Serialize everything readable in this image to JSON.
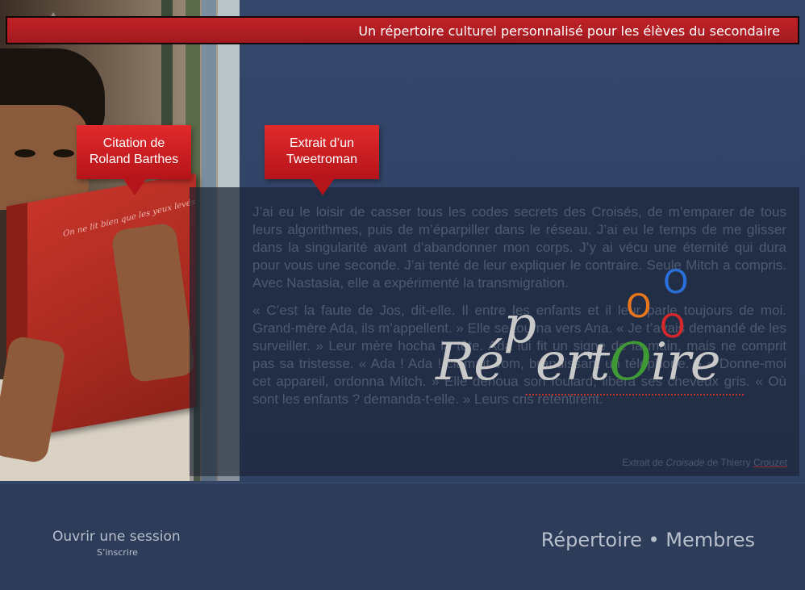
{
  "banner": {
    "tagline": "Un répertoire culturel personnalisé pour les élèves du secondaire"
  },
  "callouts": {
    "quote": {
      "line1": "Citation de",
      "line2": "Roland Barthes"
    },
    "excerpt": {
      "line1": "Extrait d’un",
      "line2": "Tweetroman"
    }
  },
  "book": {
    "cover_text": "On ne lit bien que les yeux levés"
  },
  "excerpt": {
    "paragraph1": "J’ai eu le loisir de casser tous les codes secrets des Croisés, de m’emparer de tous leurs algorithmes, puis de m’éparpiller dans le réseau. J’ai eu le temps de me glisser dans la singularité avant d’abandonner mon corps. J’y ai vécu une éternité qui dura pour vous une seconde. J’ai tenté de leur expliquer le contraire. Seule Mitch a compris. Avec Nastasia, elle a expérimenté la transmigration.",
    "paragraph2": "« C’est la faute de Jos, dit-elle. Il entre les enfants et il leur parle toujours de moi. Grand-mère Ada, ils m’appellent. » Elle se tourna vers Ana. « Je t’avais demandé de les surveiller. » Leur mère hocha la tête. Ada lui fit un signe de la main, mais ne comprit pas sa tristesse. « Ada ! Ada ! clamait Tom, brandissant un téléphone. » « Donne-moi cet appareil, ordonna Mitch. » Elle dénoua son foulard, libéra ses cheveux gris. « Où sont les enfants ? demanda-t-elle. » Leurs cris retentirent.",
    "credit_prefix": "Extrait de ",
    "credit_work": "Croisade",
    "credit_middle": " de Thierry ",
    "credit_author": "Crouzet"
  },
  "logo": {
    "word_part1": "Ré",
    "word_raised": "p",
    "word_part2": "ert",
    "word_o": "O",
    "word_part3": "ire",
    "floating_o": [
      "O",
      "O",
      "O"
    ],
    "colors": {
      "blue": "#2a6fd9",
      "orange": "#e8761c",
      "red": "#d6282a",
      "green": "#3f9a35",
      "grey": "#c9c9c9"
    }
  },
  "footer": {
    "login": "Ouvrir une session",
    "signup": "S’inscrire",
    "nav_repertoire": "Répertoire",
    "nav_separator": " • ",
    "nav_members": "Membres"
  },
  "colors": {
    "background": "#2e3e5c",
    "banner": "#b51e23",
    "callout": "#cf2025"
  }
}
